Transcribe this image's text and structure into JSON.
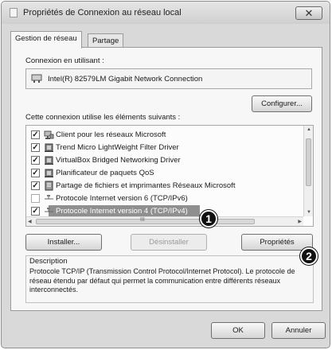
{
  "window": {
    "title": "Propriétés de Connexion au réseau local",
    "close_glyph": "✕"
  },
  "tabs": [
    {
      "label": "Gestion de réseau",
      "active": true
    },
    {
      "label": "Partage",
      "active": false
    }
  ],
  "connection": {
    "label": "Connexion en utilisant :",
    "adapter": "Intel(R) 82579LM Gigabit Network Connection",
    "configure_label": "Configurer..."
  },
  "items_label": "Cette connexion utilise les éléments suivants :",
  "items": [
    {
      "label": "Client pour les réseaux Microsoft",
      "checked": true,
      "icon": "network-client-icon"
    },
    {
      "label": "Trend Micro LightWeight Filter Driver",
      "checked": true,
      "icon": "driver-icon"
    },
    {
      "label": "VirtualBox Bridged Networking Driver",
      "checked": true,
      "icon": "driver-icon"
    },
    {
      "label": "Planificateur de paquets QoS",
      "checked": true,
      "icon": "driver-icon"
    },
    {
      "label": "Partage de fichiers et imprimantes Réseaux Microsoft",
      "checked": true,
      "icon": "file-share-icon"
    },
    {
      "label": "Protocole Internet version 6 (TCP/IPv6)",
      "checked": false,
      "icon": "protocol-icon"
    },
    {
      "label": "Protocole Internet version 4 (TCP/IPv4)",
      "checked": true,
      "icon": "protocol-icon",
      "selected": true
    }
  ],
  "scrollbar_grip": "III",
  "buttons": {
    "install": "Installer...",
    "uninstall": "Désinstaller",
    "properties": "Propriétés",
    "ok": "OK",
    "cancel": "Annuler"
  },
  "description": {
    "title": "Description",
    "text": "Protocole TCP/IP (Transmission Control Protocol/Internet Protocol). Le protocole de réseau étendu par défaut qui permet la communication entre différents réseaux interconnectés."
  },
  "markers": [
    "1",
    "2"
  ]
}
